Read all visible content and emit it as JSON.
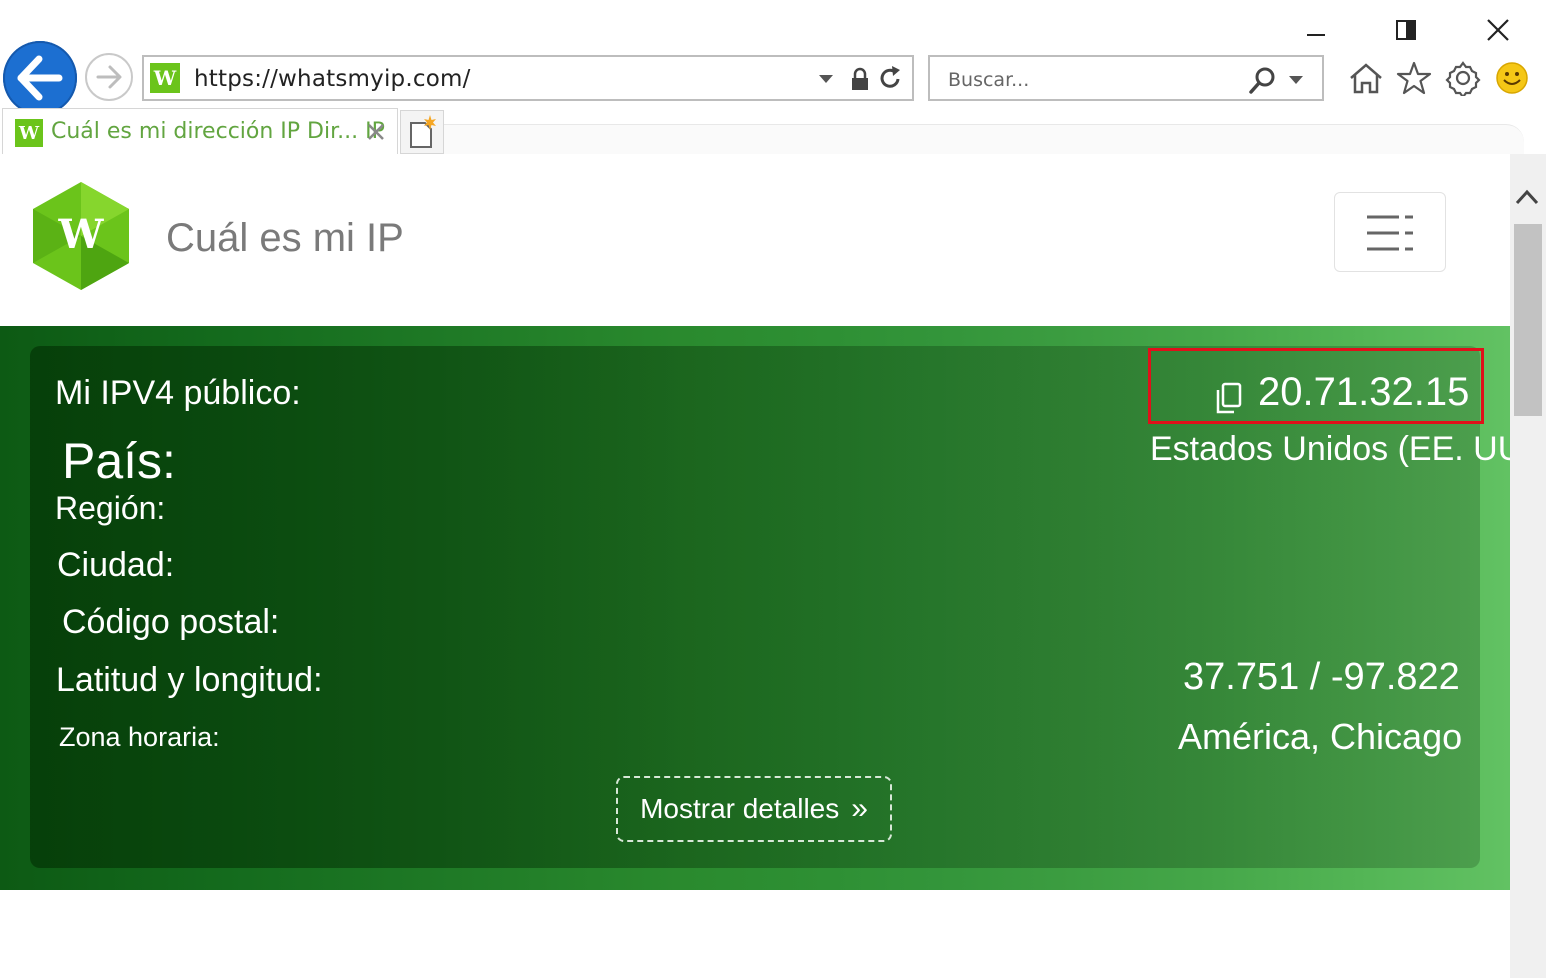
{
  "browser": {
    "address": "https://whatsmyip.com/",
    "search_placeholder": "Buscar...",
    "tab_title": "Cuál es mi dirección IP Dir... IP",
    "colors": {
      "back_button": "#1c6fd1",
      "tab_text": "#62a540"
    }
  },
  "site": {
    "title": "Cuál es mi IP",
    "logo_letter": "W",
    "logo_color": "#6bc41b"
  },
  "ipinfo": {
    "labels": {
      "ipv4": "Mi IPV4 público:",
      "country": "País:",
      "region": "Región:",
      "city": "Ciudad:",
      "postal": "Código postal:",
      "latlon": "Latitud y longitud:",
      "timezone": "Zona horaria:"
    },
    "values": {
      "ipv4": "20.71.32.15",
      "country": "Estados Unidos (EE. UU.",
      "latlon": "37.751 / -97.822",
      "timezone": "América, Chicago"
    },
    "details_button": "Mostrar detalles",
    "details_chevron": "»",
    "highlight_color": "#e0101a"
  }
}
